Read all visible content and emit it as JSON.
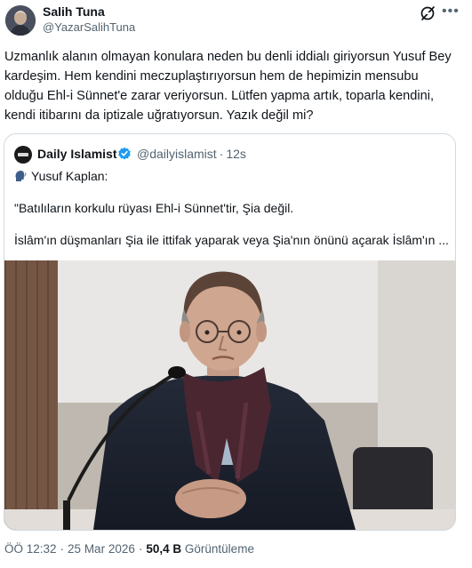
{
  "author": {
    "name": "Salih Tuna",
    "handle": "@YazarSalihTuna"
  },
  "tweet": {
    "text": "Uzmanlık alanın olmayan konulara neden bu denli iddialı giriyorsun Yusuf Bey kardeşim. Hem kendini meczuplaştırıyorsun hem de hepimizin mensubu olduğu Ehl-i Sünnet'e zarar veriyorsun. Lütfen yapma artık, toparla kendini, kendi itibarını da iptizale uğratıyorsun. Yazık değil mi?"
  },
  "quote": {
    "name": "Daily Islamist",
    "handle": "@dailyislamist",
    "separator": "·",
    "time": "12s",
    "line1": "Yusuf Kaplan:",
    "line2": "\"Batılıların korkulu rüyası Ehl-i Sünnet'tir, Şia değil.",
    "line3": "İslâm'ın düşmanları Şia ile ittifak yaparak veya Şia'nın önünü açarak İslâm'ın ..."
  },
  "footer": {
    "time": "ÖÖ 12:32",
    "separator": "·",
    "date": "25 Mar 2026",
    "views_count": "50,4 B",
    "views_label": "Görüntüleme"
  },
  "colors": {
    "text": "#0f1419",
    "secondary": "#536471",
    "verified": "#1d9bf0",
    "border": "#cfd9de"
  },
  "icons": [
    "grok-icon",
    "more-icon",
    "verified-badge-icon",
    "speaking-head-icon"
  ]
}
